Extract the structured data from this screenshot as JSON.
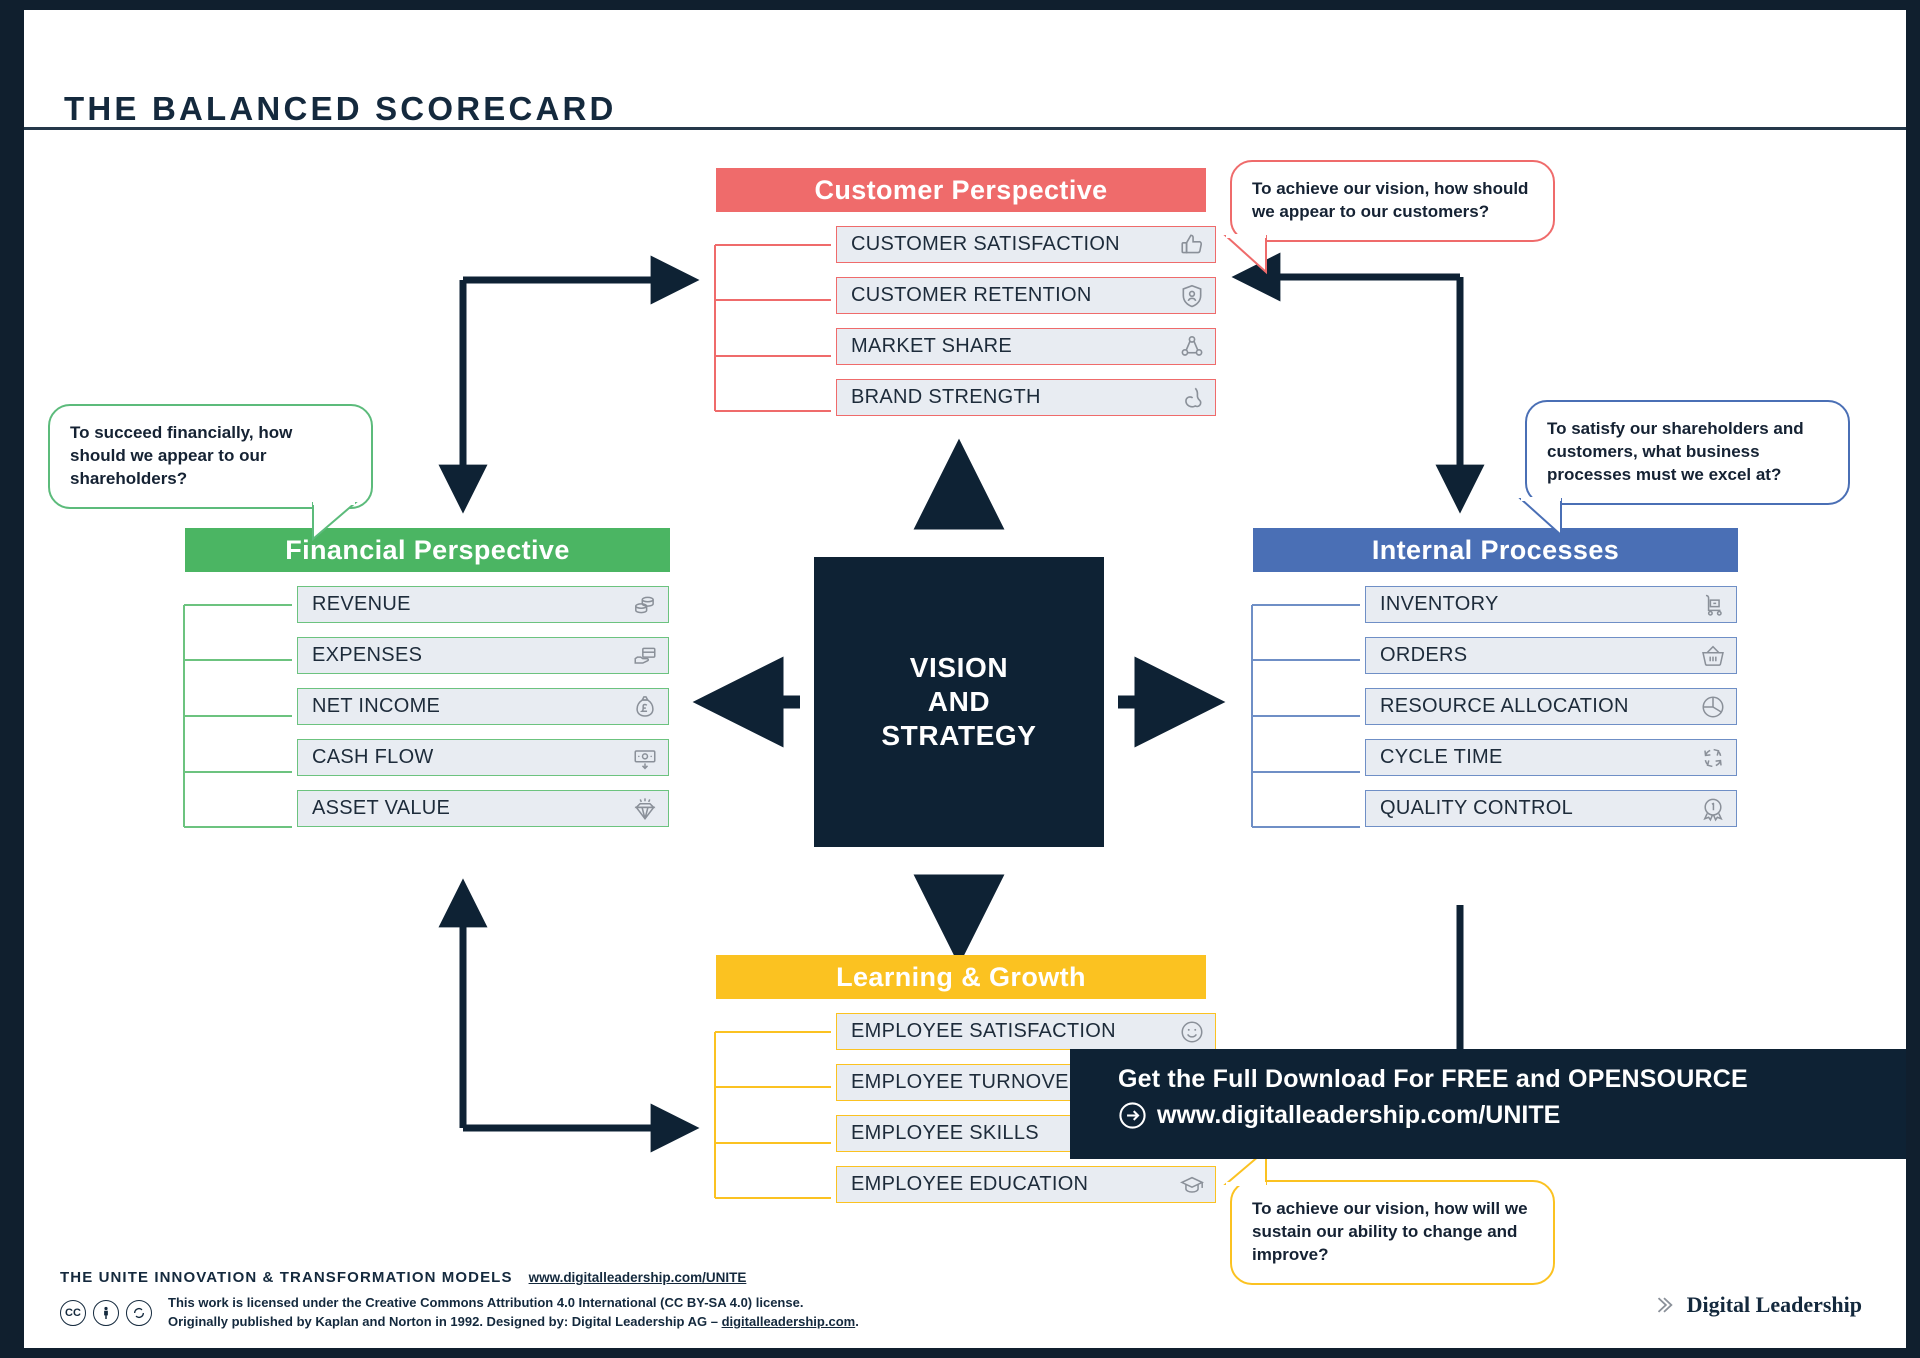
{
  "header": {
    "title": "THE BALANCED SCORECARD"
  },
  "center": {
    "line1": "VISION",
    "line2": "AND",
    "line3": "STRATEGY"
  },
  "colors": {
    "customer": "#ef6b6b",
    "financial": "#4bb563",
    "internal": "#4a6fb5",
    "learning": "#fbc221",
    "dark": "#0e2234",
    "row_bg": "#e8ecf2"
  },
  "perspectives": [
    {
      "key": "customer",
      "title": "Customer Perspective",
      "accent": "#ef6b6b",
      "items": [
        {
          "label": "CUSTOMER SATISFACTION",
          "icon": "thumbs-up-icon"
        },
        {
          "label": "CUSTOMER RETENTION",
          "icon": "shield-person-icon"
        },
        {
          "label": "MARKET SHARE",
          "icon": "share-network-icon"
        },
        {
          "label": "BRAND STRENGTH",
          "icon": "flexed-bicep-icon"
        }
      ]
    },
    {
      "key": "financial",
      "title": "Financial Perspective",
      "accent": "#4bb563",
      "items": [
        {
          "label": "REVENUE",
          "icon": "coin-stack-icon"
        },
        {
          "label": "EXPENSES",
          "icon": "hand-card-payment-icon"
        },
        {
          "label": "NET INCOME",
          "icon": "money-bag-pound-icon"
        },
        {
          "label": "CASH FLOW",
          "icon": "banknote-download-icon"
        },
        {
          "label": "ASSET VALUE",
          "icon": "diamond-icon"
        }
      ]
    },
    {
      "key": "internal",
      "title": "Internal Processes",
      "accent": "#4a6fb5",
      "items": [
        {
          "label": "INVENTORY",
          "icon": "hand-truck-icon"
        },
        {
          "label": "ORDERS",
          "icon": "shopping-basket-icon"
        },
        {
          "label": "RESOURCE ALLOCATION",
          "icon": "pie-chart-icon"
        },
        {
          "label": "CYCLE TIME",
          "icon": "cycle-arrows-icon"
        },
        {
          "label": "QUALITY CONTROL",
          "icon": "award-badge-icon"
        }
      ]
    },
    {
      "key": "learning",
      "title": "Learning & Growth",
      "accent": "#fbc221",
      "items": [
        {
          "label": "EMPLOYEE SATISFACTION",
          "icon": "smiley-face-icon"
        },
        {
          "label": "EMPLOYEE TURNOVER",
          "icon": "user-exchange-icon"
        },
        {
          "label": "EMPLOYEE SKILLS",
          "icon": "skill-gauge-icon"
        },
        {
          "label": "EMPLOYEE EDUCATION",
          "icon": "graduation-cap-icon"
        }
      ]
    }
  ],
  "bubbles": {
    "financial": "To succeed financially, how should we appear to our shareholders?",
    "customer": "To achieve our vision, how should we appear to our customers?",
    "internal": "To satisfy our shareholders and customers, what business processes must we excel at?",
    "learning": "To achieve our vision, how will we sustain our ability to change and improve?"
  },
  "promo": {
    "line1": "Get the Full Download For FREE and OPENSOURCE",
    "line2": "www.digitalleadership.com/UNITE",
    "arrow_icon": "arrow-right-circle-icon"
  },
  "footer": {
    "title": "THE UNITE INNOVATION & TRANSFORMATION MODELS",
    "url": "www.digitalleadership.com/UNITE",
    "cc_badges": [
      "CC",
      "BY",
      "SA"
    ],
    "license_line1": "This work is licensed under the Creative Commons Attribution 4.0 International (CC BY-SA 4.0) license.",
    "license_line2_pre": "Originally published by Kaplan and Norton in 1992. Designed by: Digital Leadership AG – ",
    "license_line2_link": "digitalleadership.com",
    "license_line2_post": "."
  },
  "brand": {
    "name": "Digital Leadership",
    "icon": "chevron-right-icon"
  }
}
